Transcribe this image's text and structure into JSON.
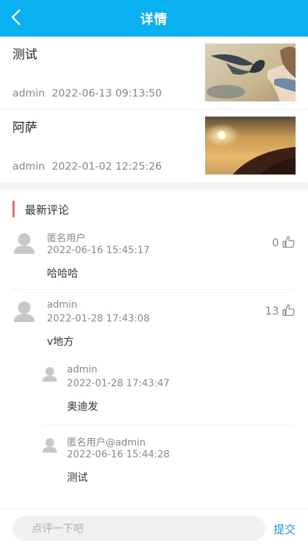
{
  "header": {
    "title": "详情",
    "back_icon": "chevron-left-icon"
  },
  "articles": [
    {
      "title": "测试",
      "author": "admin",
      "time": "2022-06-13 09:13:50",
      "thumb": "bird-photo"
    },
    {
      "title": "阿萨",
      "author": "admin",
      "time": "2022-01-02 12:25:26",
      "thumb": "sunset-photo"
    }
  ],
  "comments_section": {
    "title": "最新评论"
  },
  "comments": [
    {
      "user": "匿名用户",
      "time": "2022-06-16 15:45:17",
      "likes": "0",
      "text": "哈哈哈"
    },
    {
      "user": "admin",
      "time": "2022-01-28 17:43:08",
      "likes": "13",
      "text": "v地方",
      "replies": [
        {
          "user": "admin",
          "time": "2022-01-28 17:43:47",
          "text": "奥迪发"
        },
        {
          "user": "匿名用户@admin",
          "time": "2022-06-16 15:44:28",
          "text": "测试"
        }
      ]
    }
  ],
  "footer": {
    "placeholder": "点评一下吧",
    "submit_label": "提交"
  },
  "colors": {
    "header": "#0ab0f0",
    "accent_bar": "#e26b6b",
    "submit": "#1a9ae0"
  }
}
